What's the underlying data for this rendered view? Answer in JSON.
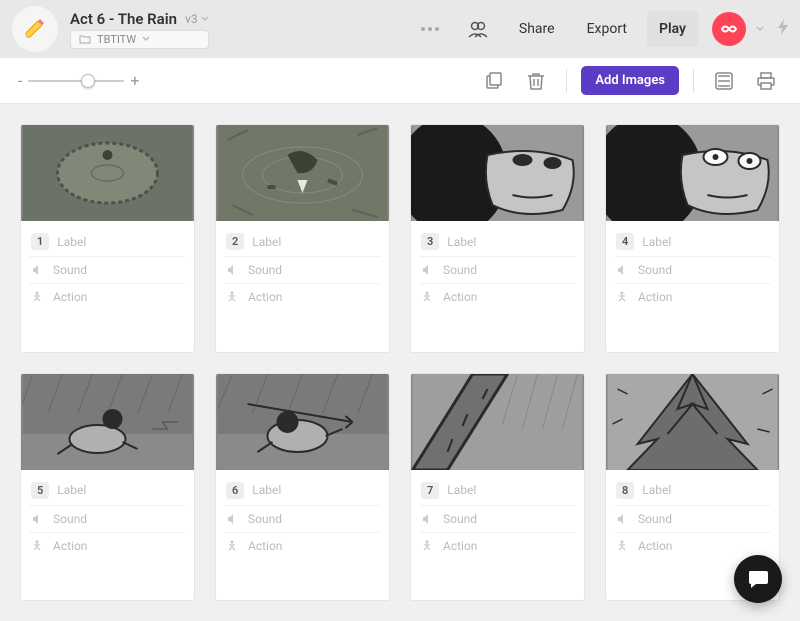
{
  "header": {
    "title": "Act 6 - The Rain",
    "version": "v3",
    "folder": "TBTITW",
    "share": "Share",
    "export": "Export",
    "play": "Play"
  },
  "toolbar": {
    "zoom_minus": "-",
    "zoom_plus": "+",
    "zoom_pct": 55,
    "add_images": "Add Images"
  },
  "row_labels": {
    "label": "Label",
    "sound": "Sound",
    "action": "Action"
  },
  "cards": [
    {
      "num": "1"
    },
    {
      "num": "2"
    },
    {
      "num": "3"
    },
    {
      "num": "4"
    },
    {
      "num": "5"
    },
    {
      "num": "6"
    },
    {
      "num": "7"
    },
    {
      "num": "8"
    }
  ]
}
